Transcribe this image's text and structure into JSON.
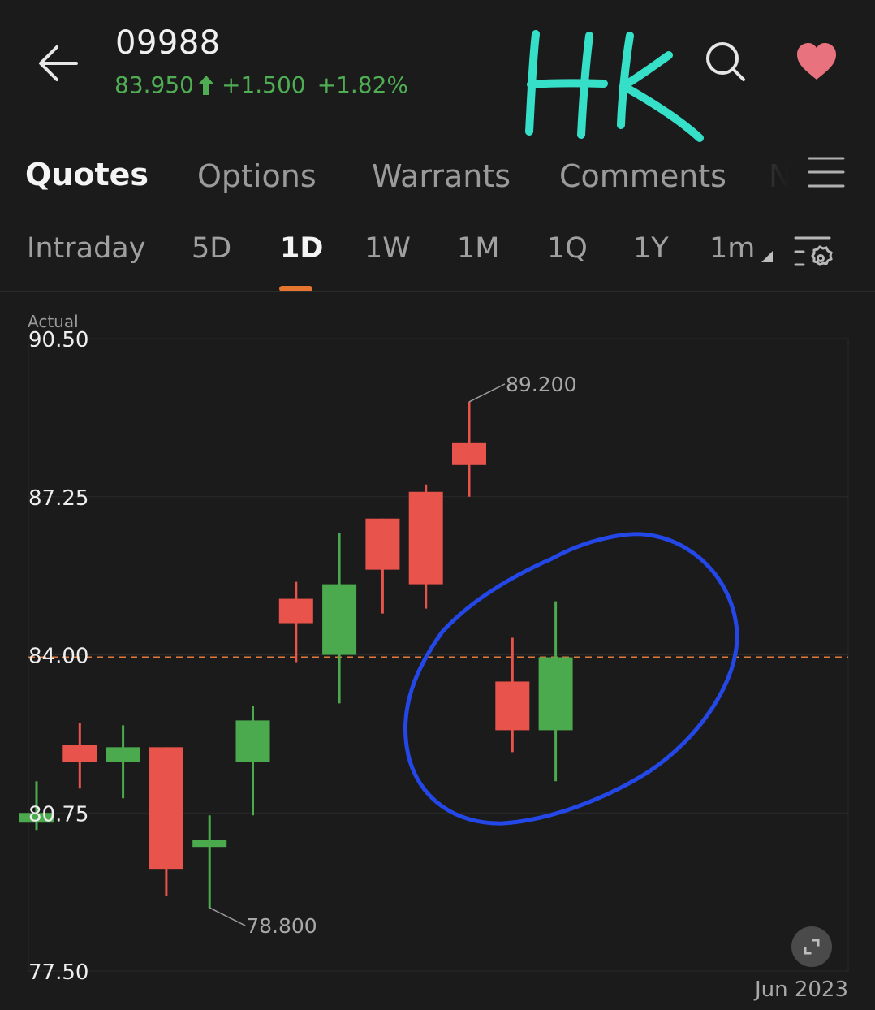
{
  "header": {
    "ticker": "09988",
    "price": "83.950",
    "change": "+1.500",
    "change_pct": "+1.82%",
    "direction": "up",
    "up_color": "#4fae53",
    "annotation_text": "HK",
    "annotation_color": "#36e0c8",
    "icons": {
      "back": "arrow-left-icon",
      "search": "search-icon",
      "favorite": "heart-icon",
      "favorite_color": "#e8737e"
    }
  },
  "main_tabs": [
    {
      "label": "Quotes",
      "active": true
    },
    {
      "label": "Options",
      "active": false
    },
    {
      "label": "Warrants",
      "active": false
    },
    {
      "label": "Comments",
      "active": false
    },
    {
      "label": "N",
      "active": false
    }
  ],
  "periods": [
    {
      "label": "Intraday",
      "active": false
    },
    {
      "label": "5D",
      "active": false
    },
    {
      "label": "1D",
      "active": true
    },
    {
      "label": "1W",
      "active": false
    },
    {
      "label": "1M",
      "active": false
    },
    {
      "label": "1Q",
      "active": false
    },
    {
      "label": "1Y",
      "active": false
    },
    {
      "label": "1m",
      "active": false,
      "dropdown": true
    }
  ],
  "chart_label": "Actual",
  "month_label": "Jun 2023",
  "chart_data": {
    "type": "candlestick",
    "title": "",
    "xlabel": "Jun 2023",
    "ylabel": "Actual",
    "ylim": [
      77.5,
      90.5
    ],
    "yticks": [
      "90.50",
      "87.25",
      "84.00",
      "80.75",
      "77.50"
    ],
    "grid": true,
    "up_color": "#4caa4e",
    "down_color": "#e8534c",
    "reference_line": {
      "value": 83.95,
      "style": "dashed",
      "color": "#e07a3a"
    },
    "annotations": [
      {
        "label": "89.200",
        "value": 89.2,
        "type": "high"
      },
      {
        "label": "78.800",
        "value": 78.8,
        "type": "low"
      }
    ],
    "candles": [
      {
        "open": 80.55,
        "high": 81.4,
        "low": 80.4,
        "close": 80.75,
        "slot": 0
      },
      {
        "open": 82.15,
        "high": 82.6,
        "low": 81.25,
        "close": 81.8,
        "slot": 1
      },
      {
        "open": 81.8,
        "high": 82.55,
        "low": 81.05,
        "close": 82.1,
        "slot": 2
      },
      {
        "open": 82.1,
        "high": 82.1,
        "low": 79.05,
        "close": 79.6,
        "slot": 3
      },
      {
        "open": 80.05,
        "high": 80.7,
        "low": 78.8,
        "close": 80.2,
        "slot": 4
      },
      {
        "open": 81.8,
        "high": 82.95,
        "low": 80.7,
        "close": 82.65,
        "slot": 5
      },
      {
        "open": 85.15,
        "high": 85.5,
        "low": 83.85,
        "close": 84.65,
        "slot": 6
      },
      {
        "open": 84.0,
        "high": 86.5,
        "low": 83.0,
        "close": 85.45,
        "slot": 7
      },
      {
        "open": 86.8,
        "high": 86.8,
        "low": 84.85,
        "close": 85.75,
        "slot": 8
      },
      {
        "open": 87.35,
        "high": 87.5,
        "low": 84.95,
        "close": 85.45,
        "slot": 9
      },
      {
        "open": 88.35,
        "high": 89.2,
        "low": 87.25,
        "close": 87.9,
        "slot": 10
      },
      {
        "open": 83.45,
        "high": 84.35,
        "low": 82.0,
        "close": 82.45,
        "slot": 11
      },
      {
        "open": 82.45,
        "high": 85.1,
        "low": 81.4,
        "close": 83.95,
        "slot": 12
      }
    ],
    "highlight_annotation": {
      "shape": "hand-drawn ellipse",
      "color": "#2447e8",
      "covers_slots": [
        11,
        12
      ]
    }
  }
}
